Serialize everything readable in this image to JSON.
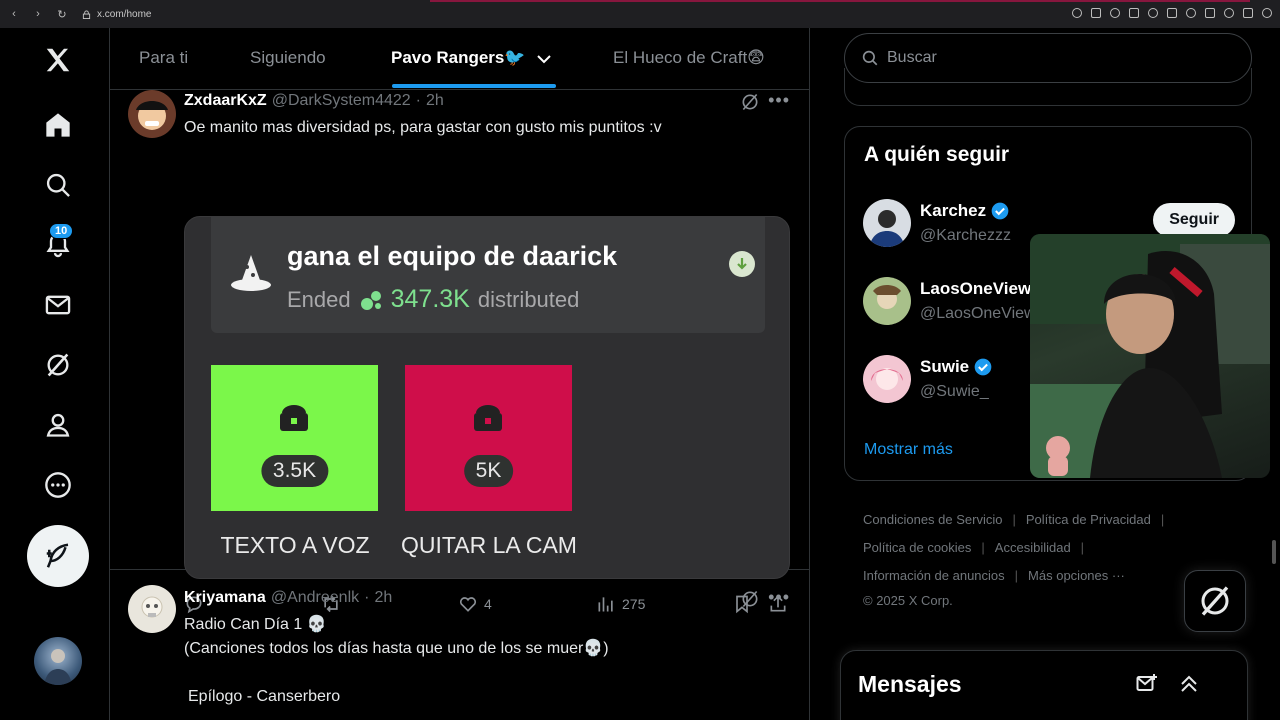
{
  "browser": {
    "url": "x.com/home"
  },
  "nav": {
    "notifications_badge": "10"
  },
  "tabs": [
    {
      "label": "Para ti"
    },
    {
      "label": "Siguiendo"
    },
    {
      "label": "Pavo Rangers🐦"
    },
    {
      "label": "El Hueco de Craft😨"
    }
  ],
  "tweets": [
    {
      "name": "ZxdaarKxZ",
      "handle": "@DarkSystem4422",
      "dot": "·",
      "time": "2h",
      "text": "Oe manito mas diversidad ps, para gastar con  gusto mis puntitos :v",
      "prediction": {
        "title": "gana el equipo de daarick",
        "status": "Ended",
        "points": "347.3K",
        "suffix": "distributed",
        "options": [
          {
            "amount": "3.5K",
            "label": "TEXTO A VOZ",
            "color": "#7bf74a"
          },
          {
            "amount": "5K",
            "label": "QUITAR LA CAM",
            "color": "#cf0e4a"
          }
        ]
      },
      "stats": {
        "likes": "4",
        "views": "275"
      }
    },
    {
      "name": "Kriyamana",
      "handle": "@Andreenlk",
      "dot": "·",
      "time": "2h",
      "lines": [
        "Radio Can Día 1 💀",
        "(Canciones todos los días hasta que uno de los se muer💀)",
        "",
        " Epílogo - Canserbero"
      ]
    }
  ],
  "right": {
    "search_placeholder": "Buscar",
    "follow_title": "A quién seguir",
    "follow": [
      {
        "name": "Karchez",
        "handle": "@Karchezzz",
        "verified": true
      },
      {
        "name": "LaosOneView",
        "handle": "@LaosOneView",
        "verified": false
      },
      {
        "name": "Suwie",
        "handle": "@Suwie_",
        "verified": true
      }
    ],
    "follow_button": "Seguir",
    "show_more": "Mostrar más",
    "footer": {
      "terms": "Condiciones de Servicio",
      "privacy": "Política de Privacidad",
      "cookies": "Política de cookies",
      "accessibility": "Accesibilidad",
      "ads": "Información de anuncios",
      "more": "Más opciones ···",
      "copyright": "© 2025 X Corp."
    },
    "messages_title": "Mensajes"
  },
  "colors": {
    "accent": "#1d9bf0",
    "bg": "#000000",
    "option_green": "#7bf74a",
    "option_red": "#cf0e4a"
  }
}
